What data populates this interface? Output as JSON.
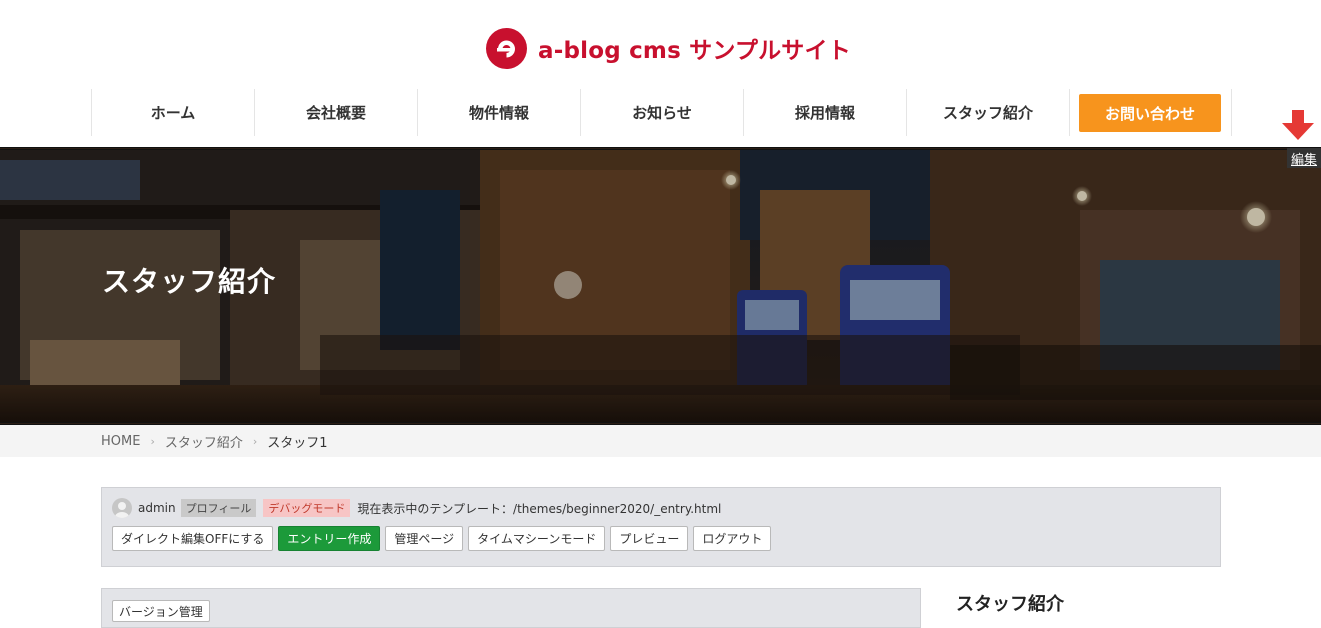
{
  "site": {
    "title": "a-blog cms サンプルサイト",
    "brand_color": "#c8102e"
  },
  "nav": {
    "items": [
      {
        "label": "ホーム"
      },
      {
        "label": "会社概要"
      },
      {
        "label": "物件情報"
      },
      {
        "label": "お知らせ"
      },
      {
        "label": "採用情報"
      },
      {
        "label": "スタッフ紹介"
      }
    ],
    "contact_label": "お問い合わせ",
    "contact_color": "#f7941d"
  },
  "edit": {
    "label": "編集",
    "arrow_icon": "down-arrow-icon",
    "arrow_color": "#e53935"
  },
  "hero": {
    "title": "スタッフ紹介"
  },
  "breadcrumb": {
    "items": [
      "HOME",
      "スタッフ紹介",
      "スタッフ1"
    ],
    "separator": "›"
  },
  "admin": {
    "user": "admin",
    "profile_tag": "プロフィール",
    "debug_tag": "デバッグモード",
    "template_text": "現在表示中のテンプレート：/themes/beginner2020/_entry.html",
    "buttons": [
      "ダイレクト編集OFFにする",
      "エントリー作成",
      "管理ページ",
      "タイムマシーンモード",
      "プレビュー",
      "ログアウト"
    ]
  },
  "version": {
    "button_label": "バージョン管理"
  },
  "sidebar": {
    "title": "スタッフ紹介"
  }
}
